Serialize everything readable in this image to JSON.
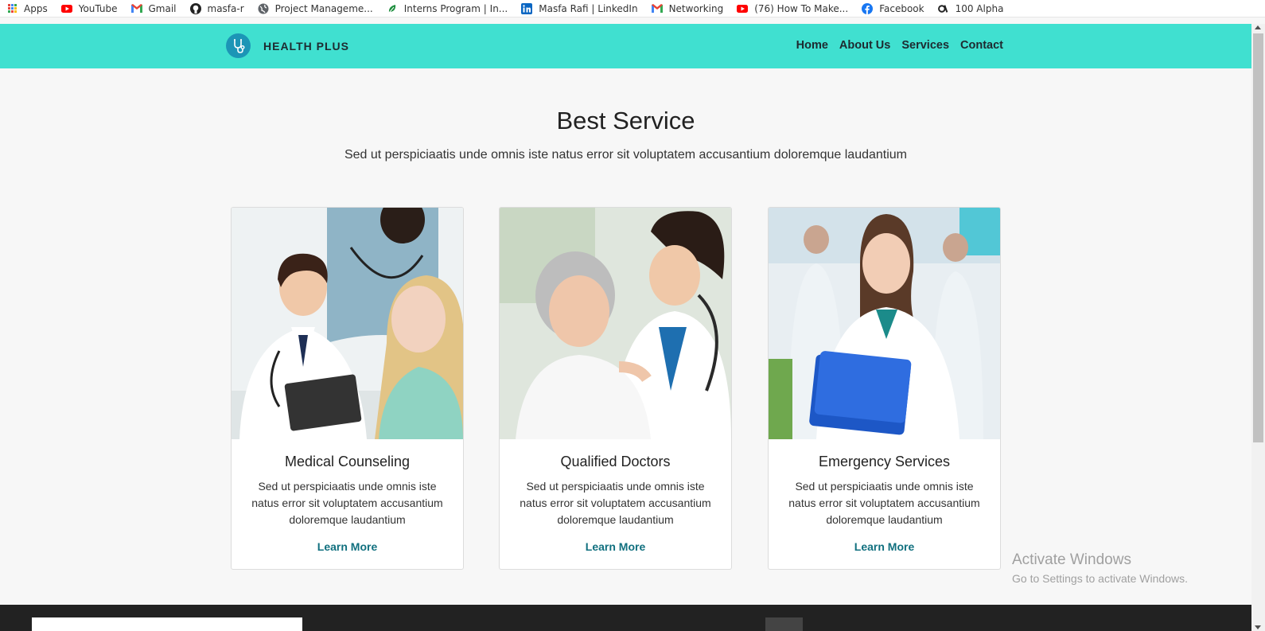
{
  "bookmarks": [
    {
      "label": "Apps",
      "icon": "apps-grid-icon"
    },
    {
      "label": "YouTube",
      "icon": "youtube-icon"
    },
    {
      "label": "Gmail",
      "icon": "gmail-icon"
    },
    {
      "label": "masfa-r",
      "icon": "github-icon"
    },
    {
      "label": "Project Manageme...",
      "icon": "globe-icon"
    },
    {
      "label": "Interns Program | In...",
      "icon": "leaf-icon"
    },
    {
      "label": "Masfa Rafi | LinkedIn",
      "icon": "linkedin-icon"
    },
    {
      "label": "Networking",
      "icon": "gmail-icon"
    },
    {
      "label": "(76) How To Make...",
      "icon": "youtube-icon"
    },
    {
      "label": "Facebook",
      "icon": "facebook-icon"
    },
    {
      "label": "100 Alpha",
      "icon": "alpha-icon"
    }
  ],
  "nav": {
    "brand": "HEALTH PLUS",
    "links": [
      "Home",
      "About Us",
      "Services",
      "Contact"
    ]
  },
  "section": {
    "title": "Best Service",
    "subtitle": "Sed ut perspiciaatis unde omnis iste natus error sit voluptatem accusantium doloremque laudantium"
  },
  "cards": [
    {
      "title": "Medical Counseling",
      "text": "Sed ut perspiciaatis unde omnis iste natus error sit voluptatem accusantium doloremque laudantium",
      "link": "Learn More"
    },
    {
      "title": "Qualified Doctors",
      "text": "Sed ut perspiciaatis unde omnis iste natus error sit voluptatem accusantium doloremque laudantium",
      "link": "Learn More"
    },
    {
      "title": "Emergency Services",
      "text": "Sed ut perspiciaatis unde omnis iste natus error sit voluptatem accusantium doloremque laudantium",
      "link": "Learn More"
    }
  ],
  "watermark": {
    "line1": "Activate Windows",
    "line2": "Go to Settings to activate Windows."
  },
  "colors": {
    "nav_bg": "#40e0d0",
    "link": "#11707f",
    "footer_bg": "#222222"
  }
}
